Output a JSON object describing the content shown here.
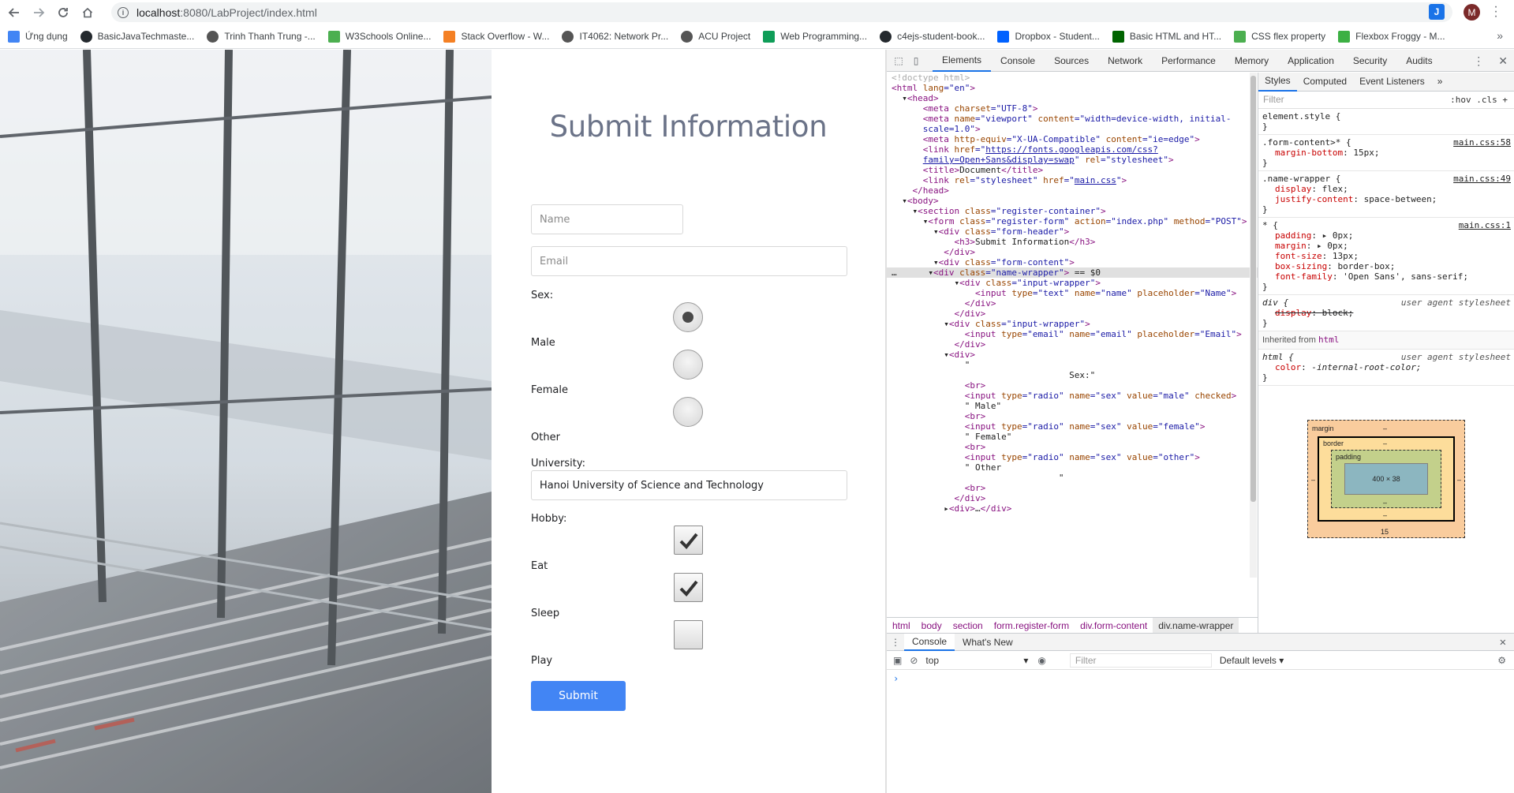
{
  "browser": {
    "url_host": "localhost",
    "url_rest": ":8080/LabProject/index.html",
    "avatar_letter": "M",
    "ext_letter": "J",
    "bookmarks": [
      {
        "label": "Ứng dụng",
        "icon": "apps-grid-icon",
        "color": "#4285f4"
      },
      {
        "label": "BasicJavaTechmaste...",
        "icon": "github-icon",
        "color": "#24292e"
      },
      {
        "label": "Trinh Thanh Trung -...",
        "icon": "globe-icon",
        "color": "#555555"
      },
      {
        "label": "W3Schools Online...",
        "icon": "w3schools-icon",
        "color": "#4caf50"
      },
      {
        "label": "Stack Overflow - W...",
        "icon": "stackoverflow-icon",
        "color": "#f48024"
      },
      {
        "label": "IT4062: Network Pr...",
        "icon": "globe-icon",
        "color": "#555555"
      },
      {
        "label": "ACU Project",
        "icon": "globe-icon",
        "color": "#555555"
      },
      {
        "label": "Web Programming...",
        "icon": "sheets-icon",
        "color": "#0f9d58"
      },
      {
        "label": "c4ejs-student-book...",
        "icon": "github-icon",
        "color": "#24292e"
      },
      {
        "label": "Dropbox - Student...",
        "icon": "dropbox-icon",
        "color": "#0061ff"
      },
      {
        "label": "Basic HTML and HT...",
        "icon": "freecodecamp-icon",
        "color": "#006400"
      },
      {
        "label": "CSS flex property",
        "icon": "w3schools-icon",
        "color": "#4caf50"
      },
      {
        "label": "Flexbox Froggy - M...",
        "icon": "frog-icon",
        "color": "#3cb043"
      }
    ]
  },
  "form": {
    "title": "Submit Information",
    "name_placeholder": "Name",
    "email_placeholder": "Email",
    "sex_label": "Sex:",
    "sex_options": [
      {
        "label": "Male",
        "checked": true
      },
      {
        "label": "Female",
        "checked": false
      },
      {
        "label": "Other",
        "checked": false
      }
    ],
    "university_label": "University:",
    "university_value": "Hanoi University of Science and Technology",
    "hobby_label": "Hobby:",
    "hobbies": [
      {
        "label": "Eat",
        "checked": true
      },
      {
        "label": "Sleep",
        "checked": true
      },
      {
        "label": "Play",
        "checked": false
      }
    ],
    "submit_label": "Submit"
  },
  "devtools": {
    "tabs": [
      "Elements",
      "Console",
      "Sources",
      "Network",
      "Performance",
      "Memory",
      "Application",
      "Security",
      "Audits"
    ],
    "active_tab": "Elements",
    "breadcrumbs": [
      "html",
      "body",
      "section",
      "form.register-form",
      "div.form-content",
      "div.name-wrapper"
    ],
    "styles_tabs": [
      "Styles",
      "Computed",
      "Event Listeners"
    ],
    "styles_filter_placeholder": "Filter",
    "hov_cls": ":hov  .cls  +",
    "rules": [
      {
        "selector": "element.style {",
        "source": "",
        "props": []
      },
      {
        "selector": ".form-content>* {",
        "source": "main.css:58",
        "props": [
          {
            "name": "margin-bottom",
            "value": "15px;"
          }
        ]
      },
      {
        "selector": ".name-wrapper {",
        "source": "main.css:49",
        "props": [
          {
            "name": "display",
            "value": "flex;"
          },
          {
            "name": "justify-content",
            "value": "space-between;"
          }
        ]
      },
      {
        "selector": "* {",
        "source": "main.css:1",
        "props": [
          {
            "name": "padding",
            "value": "▸ 0px;"
          },
          {
            "name": "margin",
            "value": "▸ 0px;"
          },
          {
            "name": "font-size",
            "value": "13px;"
          },
          {
            "name": "box-sizing",
            "value": "border-box;"
          },
          {
            "name": "font-family",
            "value": "'Open Sans', sans-serif;"
          }
        ]
      }
    ],
    "ua_rule": {
      "selector": "div {",
      "source": "user agent stylesheet",
      "prop_name": "display",
      "prop_value": "block;"
    },
    "inherited_label": "Inherited from",
    "inherited_tag": "html",
    "html_rule": {
      "selector": "html {",
      "source": "user agent stylesheet",
      "prop_name": "color",
      "prop_value": "-internal-root-color;"
    },
    "box_model": {
      "margin_label": "margin",
      "border_label": "border",
      "padding_label": "padding",
      "content_size": "400 × 38",
      "dash": "–",
      "margin_bottom": "15"
    },
    "drawer_tabs": [
      "Console",
      "What's New"
    ],
    "console_context": "top",
    "console_filter_placeholder": "Filter",
    "console_levels": "Default levels ▾",
    "prompt": "›"
  }
}
